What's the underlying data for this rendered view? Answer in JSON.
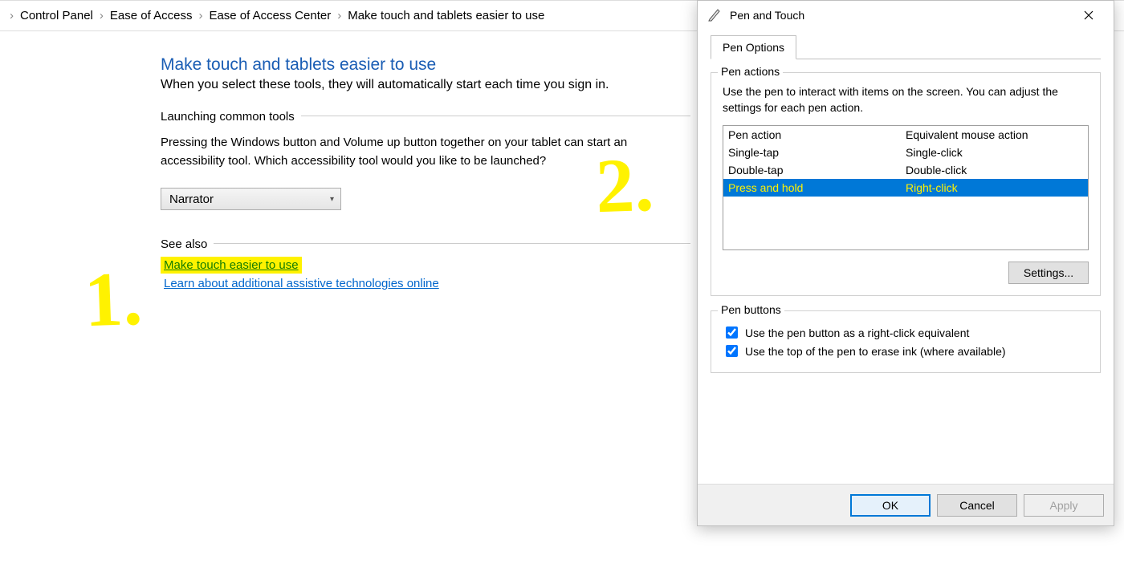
{
  "breadcrumb": {
    "items": [
      "Control Panel",
      "Ease of Access",
      "Ease of Access Center",
      "Make touch and tablets easier to use"
    ]
  },
  "page": {
    "title": "Make touch and tablets easier to use",
    "subtitle": "When you select these tools, they will automatically start each time you sign in."
  },
  "section_launch": {
    "label": "Launching common tools",
    "text": "Pressing the Windows button and Volume up button together on your tablet can start an accessibility tool. Which accessibility tool would you like to be launched?",
    "dropdown_value": "Narrator"
  },
  "section_seealso": {
    "label": "See also",
    "link1": "Make touch easier to use",
    "link2": "Learn about additional assistive technologies online"
  },
  "annotations": {
    "one": "1.",
    "two": "2."
  },
  "dialog": {
    "title": "Pen and Touch",
    "tab": "Pen Options",
    "group_pen_actions": {
      "title": "Pen actions",
      "desc": "Use the pen to interact with items on the screen.  You can adjust the settings for each pen action.",
      "col_a": "Pen action",
      "col_b": "Equivalent mouse action",
      "rows": [
        {
          "a": "Single-tap",
          "b": "Single-click"
        },
        {
          "a": "Double-tap",
          "b": "Double-click"
        },
        {
          "a": "Press and hold",
          "b": "Right-click"
        }
      ],
      "settings_btn": "Settings..."
    },
    "group_pen_buttons": {
      "title": "Pen buttons",
      "cb1": "Use the pen button as a right-click equivalent",
      "cb2": "Use the top of the pen to erase ink (where available)"
    },
    "footer": {
      "ok": "OK",
      "cancel": "Cancel",
      "apply": "Apply"
    }
  }
}
